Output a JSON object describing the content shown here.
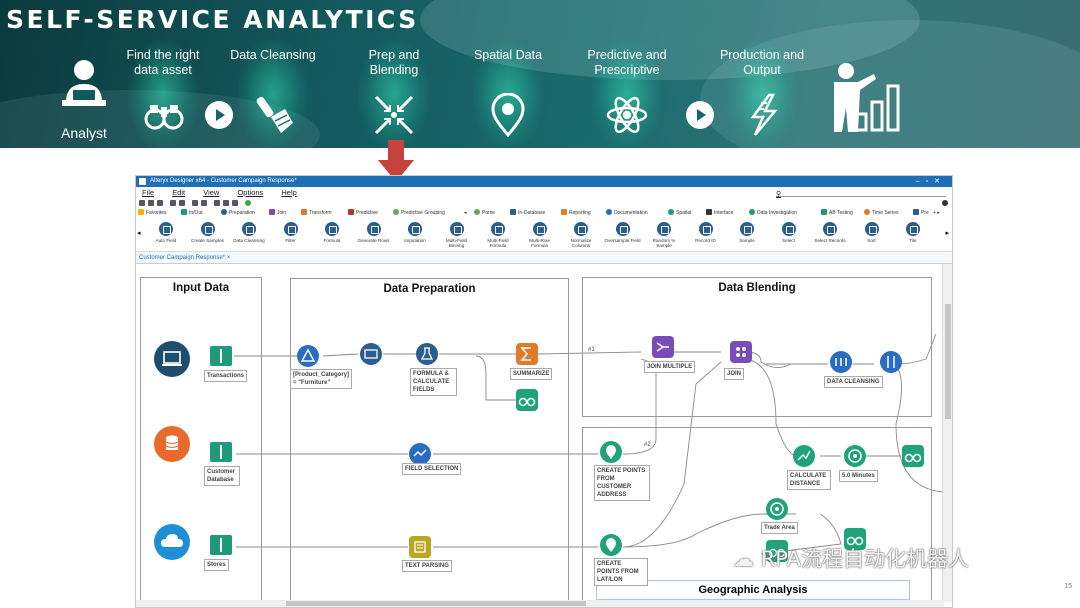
{
  "banner": {
    "title": "SELF-SERVICE ANALYTICS",
    "analyst_label": "Analyst",
    "stages": [
      {
        "label": "Find the right data asset",
        "icon": "binoculars-icon"
      },
      {
        "label": "Data Cleansing",
        "icon": "brush-icon"
      },
      {
        "label": "Prep and Blending",
        "icon": "converge-arrows-icon"
      },
      {
        "label": "Spatial Data",
        "icon": "map-pin-icon"
      },
      {
        "label": "Predictive and Prescriptive",
        "icon": "atom-icon"
      },
      {
        "label": "Production and Output",
        "icon": "lightning-icon"
      }
    ]
  },
  "app": {
    "window_title": "Alteryx Designer x64 - Customer Campaign Response*",
    "menu": [
      "File",
      "Edit",
      "View",
      "Options",
      "Help"
    ],
    "categories": [
      "Favorites",
      "In/Out",
      "Preparation",
      "Join",
      "Transform",
      "Predictive",
      "Predictive Grouping",
      "Parse",
      "In-Database",
      "Reporting",
      "Documentation",
      "Spatial",
      "Interface",
      "Data Investigation",
      "AB Testing",
      "Time Series",
      "Pre"
    ],
    "tools": [
      "Auto Field",
      "Create Samples",
      "Data Cleansing",
      "Filter",
      "Formula",
      "Generate Rows",
      "Imputation",
      "Multi-Field Binning",
      "Multi-Field Formula",
      "Multi-Row Formula",
      "Normalize Columns",
      "Oversample Field",
      "Random % Sample",
      "Record ID",
      "Sample",
      "Select",
      "Select Records",
      "Sort",
      "Tile"
    ],
    "doc_tab": "Customer Campaign Response*",
    "canvas": {
      "containers": {
        "input": "Input Data",
        "prep": "Data Preparation",
        "blend": "Data Blending",
        "geo": "Geographic Analysis"
      },
      "nodes": {
        "transactions": "Transactions",
        "customer_db": "Customer Database",
        "stores": "Stores",
        "filter": "[Product_Category] = \"Furniture\"",
        "formula": "FORMULA & CALCULATE FIELDS",
        "summarize": "SUMMARIZE",
        "field_selection": "FIELD SELECTION",
        "text_parsing": "TEXT PARSING",
        "join_multiple": "JOIN MULTIPLE",
        "join": "JOIN",
        "data_cleansing": "DATA CLEANSING",
        "create_points_cust": "CREATE POINTS FROM CUSTOMER ADDRESS",
        "calc_distance": "CALCULATE DISTANCE",
        "five_minutes": "5.0 Minutes",
        "trade_area": "Trade Area",
        "create_points_latlon": "CREATE POINTS FROM LAT/LON",
        "anchor1": "#1",
        "anchor2": "#2"
      }
    }
  },
  "watermark": "RPA流程自动化机器人",
  "page_number": "15"
}
